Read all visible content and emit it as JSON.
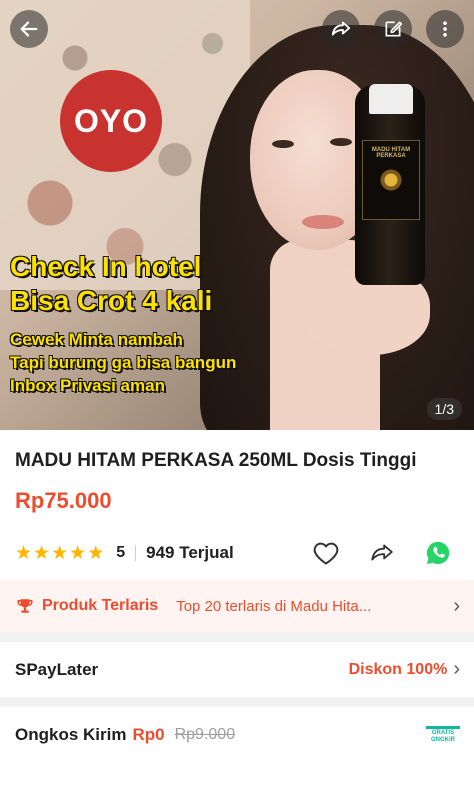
{
  "hero": {
    "brand_badge": "OYO",
    "bottle_label": "MADU HITAM PERKASA",
    "overlay_big": [
      "Check In hotel",
      "Bisa Crot 4 kali"
    ],
    "overlay_small": [
      "Cewek Minta nambah",
      "Tapi burung ga bisa bangun",
      "Inbox Privasi aman"
    ],
    "counter": "1/3"
  },
  "topbar": {
    "icons": [
      "back-arrow-icon",
      "share-icon",
      "edit-icon",
      "more-icon"
    ]
  },
  "product": {
    "title": "MADU HITAM PERKASA 250ML Dosis Tinggi",
    "price": "Rp75.000",
    "rating": "5",
    "rating_stars": 5,
    "sold": "949 Terjual"
  },
  "bestseller": {
    "label": "Produk Terlaris",
    "detail": "Top 20 terlaris di Madu Hita..."
  },
  "paylater": {
    "label": "SPayLater",
    "value": "Diskon 100%"
  },
  "shipping": {
    "label": "Ongkos Kirim",
    "price": "Rp0",
    "old_price": "Rp9.000",
    "badge_line1": "GRATIS",
    "badge_line2": "ONGKIR"
  },
  "colors": {
    "accent": "#ee4d2d",
    "star": "#ffb400",
    "whatsapp": "#25d366",
    "free_shipping": "#0fb7a0"
  }
}
